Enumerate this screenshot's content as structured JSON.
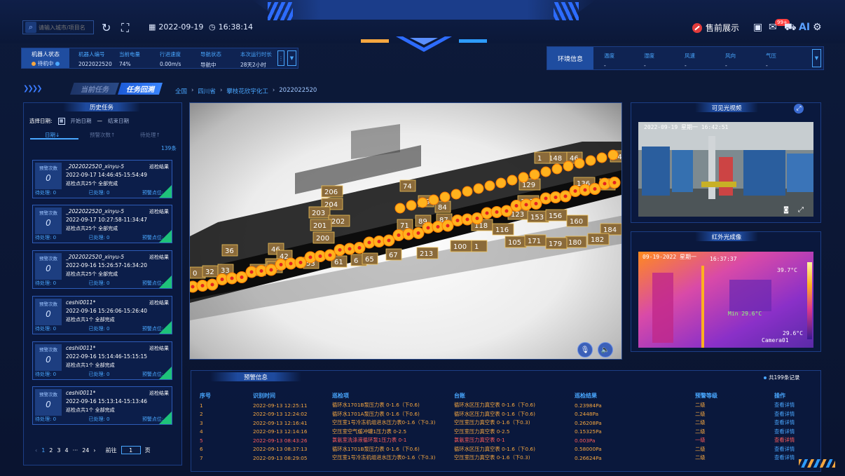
{
  "header": {
    "search_placeholder": "请输入城市/项目名",
    "date": "2022-09-19",
    "time": "16:38:14",
    "presale_label": "售前展示",
    "mail_badge": "99+",
    "ai_label": "AI"
  },
  "robot": {
    "status_label": "机器人状态",
    "status_value": "待机中",
    "fields": [
      {
        "label": "机器人编号",
        "value": "2022022520"
      },
      {
        "label": "当前电量",
        "value": "74%"
      },
      {
        "label": "行进速度",
        "value": "0.00m/s"
      },
      {
        "label": "导航状态",
        "value": "导航中"
      },
      {
        "label": "本次运行时长",
        "value": "28天2小时"
      }
    ]
  },
  "env": {
    "title": "环境信息",
    "fields": [
      {
        "label": "温度",
        "value": "-"
      },
      {
        "label": "湿度",
        "value": "-"
      },
      {
        "label": "风速",
        "value": "-"
      },
      {
        "label": "风向",
        "value": "-"
      },
      {
        "label": "气压",
        "value": "-"
      }
    ]
  },
  "tabs": {
    "current": "当前任务",
    "replay": "任务回溯"
  },
  "breadcrumb": [
    "全国",
    "四川省",
    "攀枝花欣宇化工",
    "2022022520"
  ],
  "history": {
    "title": "历史任务",
    "select_date_label": "选择日期:",
    "start_date": "开始日期",
    "dash": "—",
    "end_date": "结束日期",
    "sort_date": "日期↓",
    "sort_alert": "预警次数↑",
    "sort_pending": "待处理↑",
    "count": "139条",
    "cards": [
      {
        "alert_label": "预警次数",
        "alert_count": "0",
        "name": "_2022022520_xinyu-5",
        "result": "巡检结果",
        "time": "2022-09-17 14:46:45-15:54:49",
        "points": "巡检点共25个   全部完成",
        "pending": "待处理: 0",
        "done": "已处理: 0",
        "alerts": "预警点位: 0"
      },
      {
        "alert_label": "预警次数",
        "alert_count": "0",
        "name": "_2022022520_xinyu-5",
        "result": "巡检结果",
        "time": "2022-09-17 10:27:58-11:34:47",
        "points": "巡检点共25个   全部完成",
        "pending": "待处理: 0",
        "done": "已处理: 0",
        "alerts": "预警点位: 0"
      },
      {
        "alert_label": "预警次数",
        "alert_count": "0",
        "name": "_2022022520_xinyu-5",
        "result": "巡检结果",
        "time": "2022-09-16 15:26:57-16:34:20",
        "points": "巡检点共25个   全部完成",
        "pending": "待处理: 0",
        "done": "已处理: 0",
        "alerts": "预警点位: 0"
      },
      {
        "alert_label": "预警次数",
        "alert_count": "0",
        "name": "ceshi0011*",
        "result": "巡检结果",
        "time": "2022-09-16 15:26:06-15:26:40",
        "points": "巡检点共1个   全部完成",
        "pending": "待处理: 0",
        "done": "已处理: 0",
        "alerts": "预警点位: 0"
      },
      {
        "alert_label": "预警次数",
        "alert_count": "0",
        "name": "ceshi0011*",
        "result": "巡检结果",
        "time": "2022-09-16 15:14:46-15:15:15",
        "points": "巡检点共1个   全部完成",
        "pending": "待处理: 0",
        "done": "已处理: 0",
        "alerts": "预警点位: 0"
      },
      {
        "alert_label": "预警次数",
        "alert_count": "0",
        "name": "ceshi0011*",
        "result": "巡检结果",
        "time": "2022-09-16 15:13:14-15:13:46",
        "points": "巡检点共1个   全部完成",
        "pending": "待处理: 0",
        "done": "已处理: 0",
        "alerts": "预警点位: 0"
      }
    ],
    "pager": {
      "prev": "‹",
      "pages": [
        "1",
        "2",
        "3",
        "4",
        "···",
        "24"
      ],
      "next": "›",
      "goto": "前往",
      "page_value": "1",
      "page_suffix": "页"
    }
  },
  "map": {
    "markers": [
      "206",
      "204",
      "203",
      "202",
      "201",
      "200",
      "36",
      "46",
      "42",
      "4",
      "43",
      "44",
      "53",
      "61",
      "6",
      "65",
      "67",
      "213",
      "100",
      "1",
      "0",
      "32",
      "33",
      "74",
      "79",
      "84",
      "87",
      "89",
      "71",
      "118",
      "116",
      "123",
      "105",
      "153",
      "156",
      "160",
      "129",
      "152",
      "136",
      "148",
      "46",
      "1",
      "142",
      "8",
      "184",
      "182",
      "180",
      "179",
      "171"
    ]
  },
  "alerts": {
    "title": "预警信息",
    "total": "共199条记录",
    "columns": [
      "序号",
      "识别时间",
      "巡检项",
      "台账",
      "巡检结果",
      "预警等级",
      "操作"
    ],
    "rows": [
      {
        "no": "1",
        "time": "2022-09-13 12:25:11",
        "item": "循环水1701B泵压力表 0-1.6（下0.6)",
        "ledger": "循环水区压力真空表 0-1.6（下0.6)",
        "result": "0.23984Pa",
        "level": "二级",
        "op": "查看详情",
        "red": false
      },
      {
        "no": "2",
        "time": "2022-09-13 12:24:02",
        "item": "循环水1701A泵压力表 0-1.6（下0.6)",
        "ledger": "循环水区压力真空表 0-1.6（下0.6)",
        "result": "0.2448Pa",
        "level": "二级",
        "op": "查看详情",
        "red": false
      },
      {
        "no": "3",
        "time": "2022-09-13 12:16:41",
        "item": "空压室1号冷冻机组进水压力表0-1.6（下0.3)",
        "ledger": "空压室压力真空表 0-1.6（下0.3)",
        "result": "0.26208Pa",
        "level": "二级",
        "op": "查看详情",
        "red": false
      },
      {
        "no": "4",
        "time": "2022-09-13 12:14:16",
        "item": "空压室空气缓冲罐1压力表 0-2.5",
        "ledger": "空压室压力真空表 0-2.5",
        "result": "0.15325Pa",
        "level": "二级",
        "op": "查看详情",
        "red": false
      },
      {
        "no": "5",
        "time": "2022-09-13 08:43:26",
        "item": "氯氨室洗涤液循环泵1压力表 0-1",
        "ledger": "氯氨室压力真空表 0-1",
        "result": "0.003Pa",
        "level": "一级",
        "op": "查看详情",
        "red": true
      },
      {
        "no": "6",
        "time": "2022-09-13 08:37:13",
        "item": "循环水1701B泵压力表 0-1.6（下0.6)",
        "ledger": "循环水区压力真空表 0-1.6（下0.6)",
        "result": "0.58000Pa",
        "level": "二级",
        "op": "查看详情",
        "red": false
      },
      {
        "no": "7",
        "time": "2022-09-13 08:29:05",
        "item": "空压室1号冷冻机组进水压力表0-1.6（下0.3)",
        "ledger": "空压室压力真空表 0-1.6（下0.3)",
        "result": "0.26624Pa",
        "level": "二级",
        "op": "查看详情",
        "red": false
      }
    ]
  },
  "visible_video": {
    "title": "可见光视频",
    "overlay_text": "2022-09-19 星期一 16:42:51"
  },
  "infrared": {
    "title": "红外光成像",
    "overlay_date": "09-19-2022 星期一",
    "overlay_time": "16:37:37",
    "max_temp": "39.7°C",
    "min_label": "Min 29.6°C",
    "low_temp": "29.6°C",
    "camera_label": "Camera01"
  },
  "colors": {
    "accent": "#49a7ff",
    "warn": "#f4a640",
    "danger": "#ff5c5c",
    "ok": "#1ec27a"
  }
}
